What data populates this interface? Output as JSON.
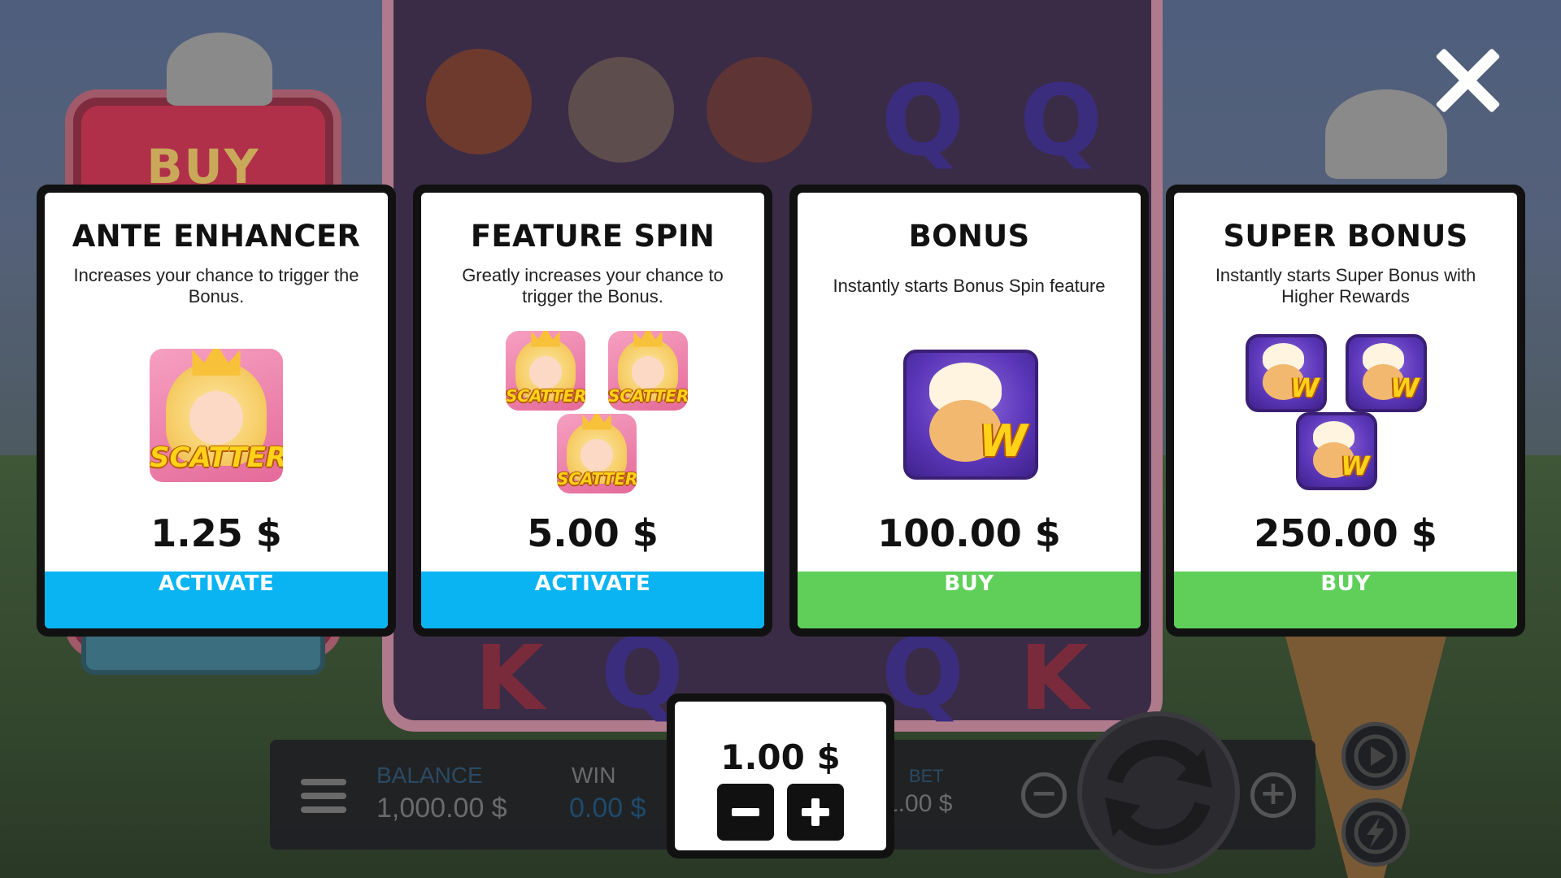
{
  "background": {
    "booth_sign": "BUY",
    "balance_label": "BALANCE",
    "balance_value": "1,000.00 $",
    "win_label": "WIN",
    "win_value": "0.00 $",
    "bet_label": "BET",
    "bet_value": "1.00 $",
    "reel_letters": [
      "Q",
      "Q",
      "K",
      "Q",
      "Q",
      "K"
    ]
  },
  "cards": [
    {
      "title": "ANTE ENHANCER",
      "description": "Increases your chance to trigger the Bonus.",
      "price": "1.25 $",
      "button": "ACTIVATE",
      "symbol_label": "SCATTER",
      "button_color": "#0ab4f2"
    },
    {
      "title": "FEATURE SPIN",
      "description": "Greatly increases your chance to trigger the Bonus.",
      "price": "5.00 $",
      "button": "ACTIVATE",
      "symbol_label": "SCATTER",
      "button_color": "#0ab4f2"
    },
    {
      "title": "BONUS",
      "description": "Instantly starts Bonus Spin feature",
      "price": "100.00 $",
      "button": "BUY",
      "symbol_label": "W",
      "button_color": "#5fcf5a"
    },
    {
      "title": "SUPER BONUS",
      "description": "Instantly starts Super Bonus with Higher Rewards",
      "price": "250.00 $",
      "button": "BUY",
      "symbol_label": "W",
      "button_color": "#5fcf5a"
    }
  ],
  "bet_popup": {
    "amount": "1.00 $",
    "decrease_icon": "minus-icon",
    "increase_icon": "plus-icon"
  },
  "icons": {
    "close": "close-icon",
    "menu": "hamburger-menu-icon",
    "spin": "spin-arrows-icon",
    "autoplay": "play-icon",
    "turbo": "lightning-icon"
  },
  "colors": {
    "activate": "#0ab4f2",
    "buy": "#5fcf5a",
    "card_border": "#111111"
  }
}
